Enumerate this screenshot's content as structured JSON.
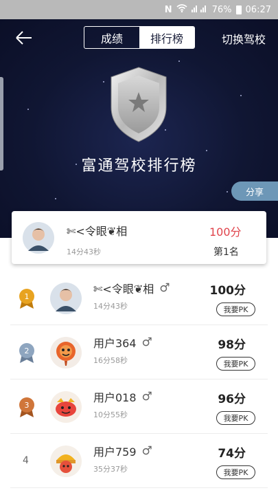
{
  "status_bar": {
    "battery": "76%",
    "time": "06:27"
  },
  "header": {
    "tabs": [
      "成绩",
      "排行榜"
    ],
    "active_tab": 1,
    "switch_school": "切换驾校",
    "title": "富通驾校排行榜",
    "share": "分享"
  },
  "my_card": {
    "name": "✄<令眼❦相",
    "time": "14分43秒",
    "score": "100分",
    "rank": "第1名"
  },
  "ranking": [
    {
      "rank": "1",
      "name": "✄<令眼❦相",
      "time": "14分43秒",
      "score": "100分",
      "pk": "我要PK",
      "medal_color": "#e8a320"
    },
    {
      "rank": "2",
      "name": "用户364",
      "time": "16分58秒",
      "score": "98分",
      "pk": "我要PK",
      "medal_color": "#8ea5bf"
    },
    {
      "rank": "3",
      "name": "用户018",
      "time": "10分55秒",
      "score": "96分",
      "pk": "我要PK",
      "medal_color": "#d0763a"
    },
    {
      "rank": "4",
      "name": "用户759",
      "time": "35分37秒",
      "score": "74分",
      "pk": "我要PK"
    }
  ],
  "colors": {
    "accent_red": "#e0434b",
    "share_blue": "#6d97b7",
    "hero_bg": "#101633"
  }
}
